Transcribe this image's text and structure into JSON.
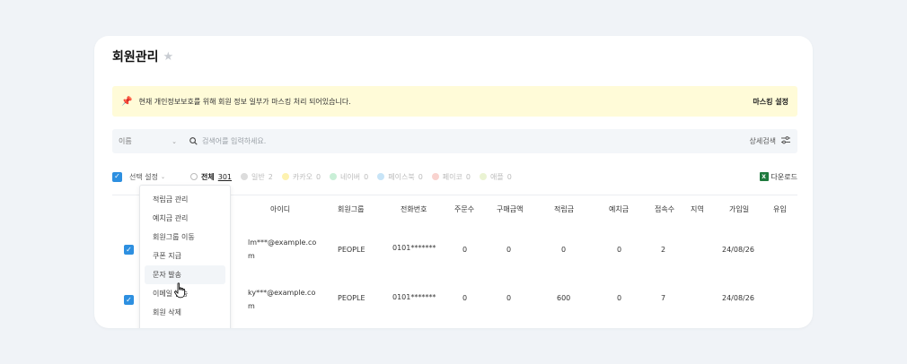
{
  "page": {
    "title": "회원관리"
  },
  "notice": {
    "text": "현재 개인정보보호를 위해 회원 정보 일부가 마스킹 처리 되어있습니다.",
    "action": "마스킹 설정"
  },
  "search": {
    "field_select": "이름",
    "placeholder": "검색어를 입력하세요.",
    "advanced_label": "상세검색"
  },
  "toolbar": {
    "select_label": "선택 설정",
    "filters": [
      {
        "label": "전체",
        "count": "301",
        "color": "#ffffff"
      },
      {
        "label": "일반",
        "count": "2",
        "color": "#dcdcdc"
      },
      {
        "label": "카카오",
        "count": "0",
        "color": "#fdf2b0"
      },
      {
        "label": "네이버",
        "count": "0",
        "color": "#c9efd7"
      },
      {
        "label": "페이스북",
        "count": "0",
        "color": "#c7e4f7"
      },
      {
        "label": "페이코",
        "count": "0",
        "color": "#f9d3cf"
      },
      {
        "label": "애플",
        "count": "0",
        "color": "#eaf3d3"
      }
    ],
    "download_label": "다운로드"
  },
  "table": {
    "columns": [
      "아이디",
      "회원그룹",
      "전화번호",
      "주문수",
      "구매금액",
      "적립금",
      "예치금",
      "접속수",
      "지역",
      "가입일",
      "유입"
    ],
    "rows": [
      {
        "id": "lm***@example.com",
        "group": "PEOPLE",
        "phone": "0101*******",
        "orders": "0",
        "purchase": "0",
        "points": "0",
        "deposit": "0",
        "visits": "2",
        "region": "",
        "joined": "24/08/26",
        "source": ""
      },
      {
        "id": "ky***@example.com",
        "group": "PEOPLE",
        "phone": "0101*******",
        "orders": "0",
        "purchase": "0",
        "points": "600",
        "deposit": "0",
        "visits": "7",
        "region": "",
        "joined": "24/08/26",
        "source": ""
      }
    ]
  },
  "dropdown": {
    "items": [
      "적립금 관리",
      "예치금 관리",
      "회원그룹 이동",
      "쿠폰 지급",
      "문자 발송",
      "이메일 발송",
      "회원 삭제"
    ]
  },
  "colors": {
    "accent": "#2d8fe0",
    "notice_bg": "#fffbd8",
    "excel": "#1f7a3e"
  }
}
